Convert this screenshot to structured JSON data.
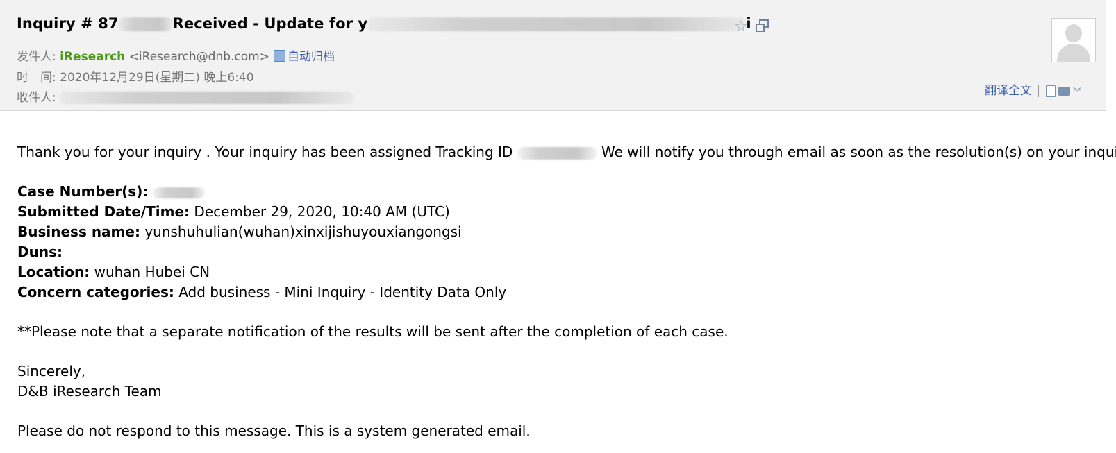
{
  "header": {
    "subject_prefix": "Inquiry # 87",
    "subject_middle": "Received - Update for y",
    "subject_suffix": "i",
    "from_label": "发件人:",
    "from_name": "iResearch",
    "from_email": "<iResearch@dnb.com>",
    "archive_label": "自动归档",
    "time_label": "时　间:",
    "time_value": "2020年12月29日(星期二) 晚上6:40",
    "to_label": "收件人:",
    "translate_label": "翻译全文",
    "separator": "|",
    "icons": [
      "star-icon",
      "popout-icon",
      "avatar",
      "archive-icon",
      "doc-icon",
      "print-icon",
      "more-icon"
    ]
  },
  "body": {
    "intro_part1": "Thank you for your inquiry . Your inquiry has been assigned Tracking ID ",
    "intro_part2": " We will notify you through email as soon as the resolution(s) on your inquiry are",
    "fields": [
      {
        "label": "Case Number(s):",
        "value": ""
      },
      {
        "label": "Submitted Date/Time:",
        "value": "December 29, 2020, 10:40 AM (UTC)"
      },
      {
        "label": "Business name:",
        "value": "yunshuhulian(wuhan)xinxijishuyouxiangongsi"
      },
      {
        "label": "Duns:",
        "value": ""
      },
      {
        "label": "Location:",
        "value": "wuhan Hubei CN"
      },
      {
        "label": "Concern categories:",
        "value": "Add business - Mini Inquiry - Identity Data Only"
      }
    ],
    "note": "**Please note that a separate notification of the results will be sent after the completion of each case.",
    "closing": "Sincerely,",
    "signature": "D&B iResearch Team",
    "footer": "Please do not respond to this message. This is a system generated email."
  },
  "colors": {
    "header_bg": "#f2f2f2",
    "sender_name": "#4d9a1c",
    "link_blue": "#3a5fa8"
  }
}
